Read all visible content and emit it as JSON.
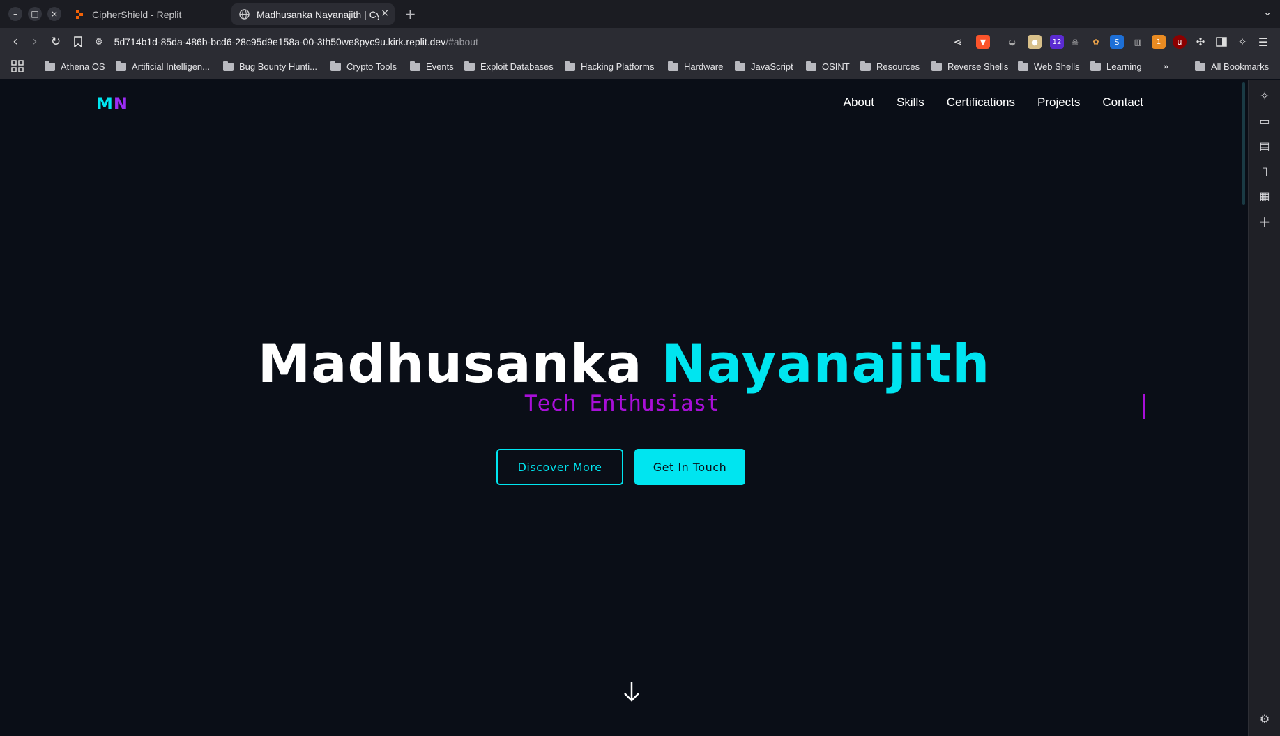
{
  "browser": {
    "tabs": [
      {
        "title": "CipherShield - Replit",
        "active": false
      },
      {
        "title": "Madhusanka Nayanajith | Cy",
        "active": true
      }
    ],
    "url_host": "5d714b1d-85da-486b-bcd6-28c95d9e158a-00-3th50we8pyc9u.kirk.replit.dev",
    "url_path": "/#about",
    "extension_badges": {
      "badge_12": "12",
      "badge_1": "1"
    },
    "bookmarks": [
      "Athena OS",
      "Artificial Intelligen...",
      "Bug Bounty Hunti...",
      "Crypto Tools",
      "Events",
      "Exploit Databases",
      "Hacking Platforms",
      "Hardware",
      "JavaScript",
      "OSINT",
      "Resources",
      "Reverse Shells",
      "Web Shells",
      "Learning"
    ],
    "all_bookmarks": "All Bookmarks"
  },
  "site": {
    "logo_m": "M",
    "logo_n": "N",
    "nav": [
      "About",
      "Skills",
      "Certifications",
      "Projects",
      "Contact"
    ],
    "hero_first": "Madhusanka",
    "hero_last": "Nayanajith",
    "hero_subtitle": "Tech Enthusiast",
    "primary_button": "Discover More",
    "secondary_button": "Get In Touch"
  },
  "colors": {
    "accent": "#00e5f0",
    "purple": "#9b2cf3",
    "subtitle": "#a80fd8",
    "background": "#0a0e17"
  }
}
